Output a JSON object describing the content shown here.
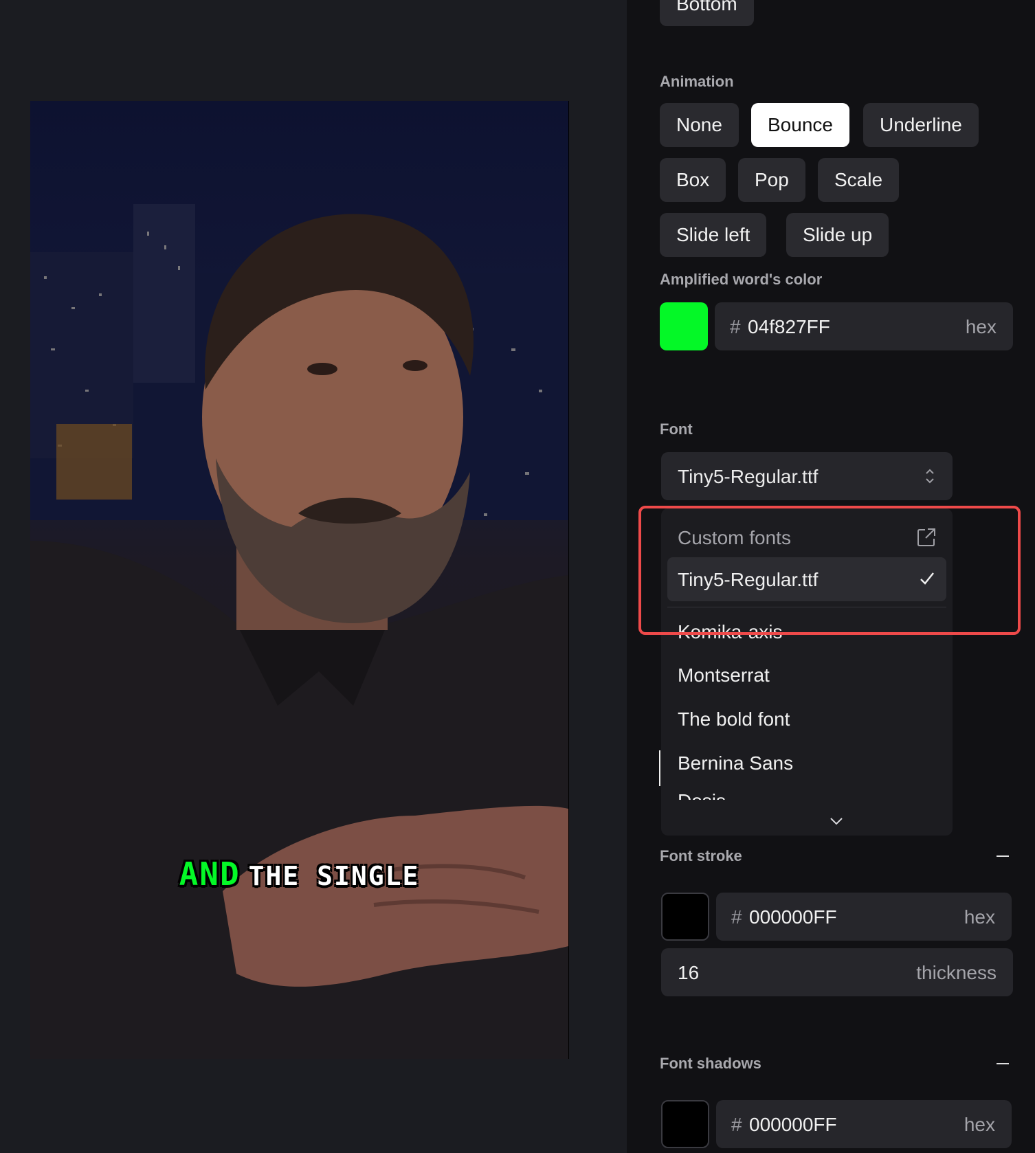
{
  "preview": {
    "caption": {
      "amplified_word": "AND",
      "rest": "THE SINGLE"
    }
  },
  "panel": {
    "position_button": "Bottom",
    "animation": {
      "label": "Animation",
      "options": [
        "None",
        "Bounce",
        "Underline",
        "Box",
        "Pop",
        "Scale",
        "Slide left",
        "Slide up"
      ],
      "selected": "Bounce"
    },
    "amplified_color": {
      "label": "Amplified word's color",
      "swatch": "#04f827",
      "hash": "#",
      "value": "04f827FF",
      "suffix": "hex"
    },
    "font": {
      "label": "Font",
      "selected": "Tiny5-Regular.ttf",
      "menu": {
        "header": "Custom fonts",
        "selected_item": "Tiny5-Regular.ttf",
        "items": [
          "Komika-axis",
          "Montserrat",
          "The bold font",
          "Bernina Sans",
          "Dosis"
        ]
      }
    },
    "font_stroke": {
      "label": "Font stroke",
      "swatch": "#000000",
      "hash": "#",
      "value": "000000FF",
      "suffix": "hex",
      "thickness_value": "16",
      "thickness_suffix": "thickness"
    },
    "font_shadows": {
      "label": "Font shadows",
      "swatch": "#000000",
      "hash": "#",
      "value": "000000FF",
      "suffix": "hex"
    }
  },
  "colors": {
    "highlight_border": "#ee4a4a",
    "active_button_bg": "#ffffff"
  },
  "icons": [
    "external-link-icon",
    "check-icon",
    "chevron-updown-icon",
    "chevron-down-icon",
    "minus-icon"
  ]
}
